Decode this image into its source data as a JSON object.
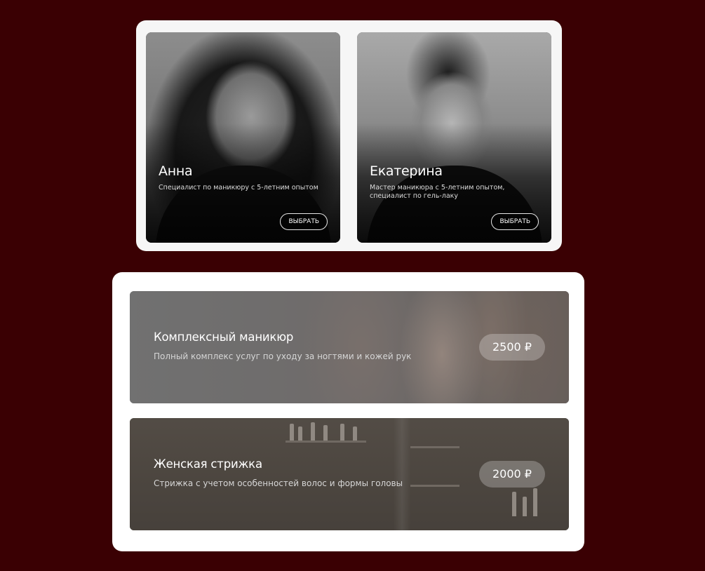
{
  "specialists": [
    {
      "name": "Анна",
      "description": "Специалист по маникюру с 5-летним опытом",
      "button_label": "ВЫБРАТЬ"
    },
    {
      "name": "Екатерина",
      "description": "Мастер маникюра с 5-летним опытом, специалист по гель-лаку",
      "button_label": "ВЫБРАТЬ"
    }
  ],
  "services": [
    {
      "title": "Комплексный маникюр",
      "description": "Полный комплекс услуг по уходу за ногтями и кожей рук",
      "price": "2500 ₽"
    },
    {
      "title": "Женская стрижка",
      "description": "Стрижка с учетом особенностей волос и формы головы",
      "price": "2000 ₽"
    }
  ],
  "colors": {
    "page_background": "#3a0003",
    "panel_background": "#ffffff"
  }
}
